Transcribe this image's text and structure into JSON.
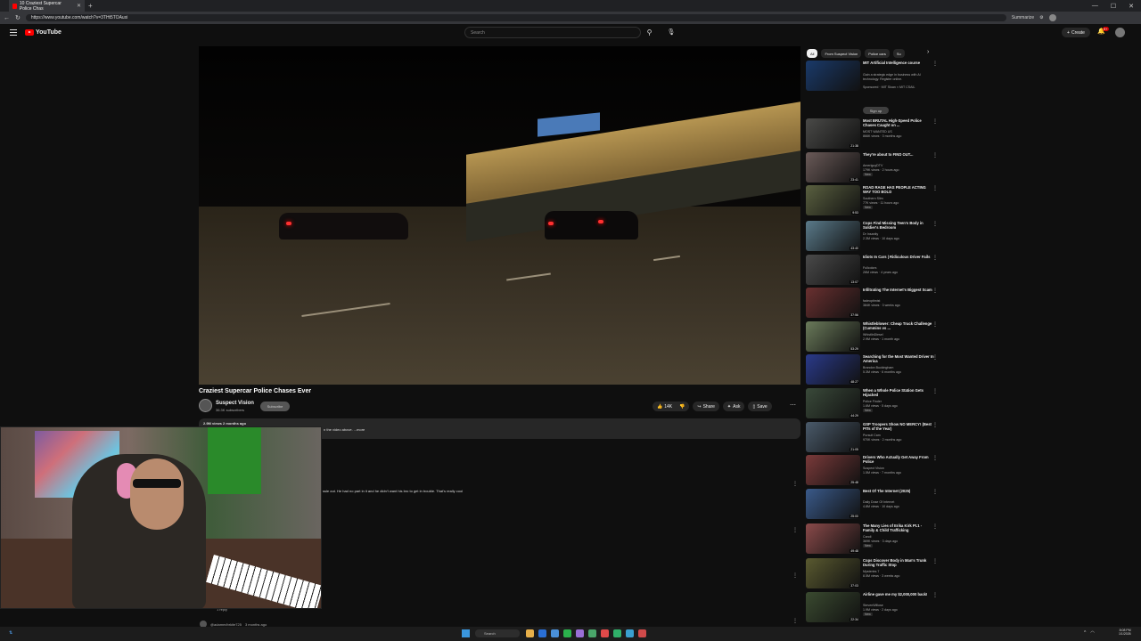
{
  "browser": {
    "tab_title": "10 Craziest Supercar Police Chas",
    "url": "https://www.youtube.com/watch?v=3THt5TOAuxi",
    "profile_label": "Summarize"
  },
  "youtube": {
    "logo_text": "YouTube",
    "search_placeholder": "Search",
    "create_label": "Create",
    "notification_count": "9+"
  },
  "video": {
    "title": "Craziest Supercar Police Chases Ever",
    "channel_name": "Suspect Vision",
    "channel_subs": "36.3K subscribers",
    "subscribe_label": "Subscribe",
    "like_count": "14K",
    "share_label": "Share",
    "ask_label": "Ask",
    "save_label": "Save",
    "views_date": "2.9M views  2 months ago",
    "description_snippet": "n the video above.  ...more"
  },
  "comments": {
    "comment_text": "ssle out. He had no part in it and he didn't want his bro to get in trouble. That's really cool",
    "reply_label": "1 reply",
    "author": "@adamm/brkite725",
    "author_time": "3 months ago"
  },
  "sidebar": {
    "chips": [
      "All",
      "From Suspect Vision",
      "Police cars",
      "Su"
    ],
    "signup_label": "Sign up",
    "items": [
      {
        "title": "MIT Artificial Intelligence course",
        "channel": "Gain a strategic edge in business with AI technology. Register online.",
        "meta": "Sponsored · MIT Sloan × MIT CSAIL",
        "duration": "",
        "badge": "",
        "thumb": "#1a3a6a"
      },
      {
        "title": "Most BRUTAL High-Speed Police Chases Caught on ...",
        "channel": "MOST WANTED US",
        "meta": "866K views · 3 months ago",
        "duration": "21:38",
        "badge": "",
        "thumb": "#4a4a48"
      },
      {
        "title": "They're about to FIND OUT...",
        "channel": "AmeriguyDTV",
        "meta": "179K views · 2 hours ago",
        "duration": "23:41",
        "badge": "New",
        "thumb": "#6a5a58"
      },
      {
        "title": "ROAD RAGE HAS PEOPLE ACTING WAY TOO BOLD",
        "channel": "Southern Slim",
        "meta": "77K views · 11 hours ago",
        "duration": "9:53",
        "badge": "New",
        "thumb": "#5a6040"
      },
      {
        "title": "Cops Find Missing Teen's Body in Soldier's Bedroom",
        "channel": "Dr Insanity",
        "meta": "2.3M views · 10 days ago",
        "duration": "43:40",
        "badge": "",
        "thumb": "#5a7a8a"
      },
      {
        "title": "Idiots In Cars | Ridiculous Driver Fails",
        "channel": "Fullcolors",
        "meta": "26M views · 4 years ago",
        "duration": "13:07",
        "badge": "",
        "thumb": "#4a4a4a"
      },
      {
        "title": "Infiltrating The Internet's Biggest Scam",
        "channel": "fadeoptimist",
        "meta": "384K views · 3 weeks ago",
        "duration": "37:56",
        "badge": "",
        "thumb": "#6a3030"
      },
      {
        "title": "Whistleblower: Cheap Truck Challenge (Cummins vs ...",
        "channel": "WhistlinDiesel",
        "meta": "2.9M views · 1 month ago",
        "duration": "53:29",
        "badge": "",
        "thumb": "#6a7a5a"
      },
      {
        "title": "Searching for the Most Wanted Driver In America",
        "channel": "Brandon Buckingham",
        "meta": "5.3M views · 6 months ago",
        "duration": "48:27",
        "badge": "",
        "thumb": "#2a3a8a"
      },
      {
        "title": "When a Whole Police Station Gets Hijacked",
        "channel": "Police Finder",
        "meta": "1.6M views · 5 days ago",
        "duration": "44:29",
        "badge": "New",
        "thumb": "#3a4a3a"
      },
      {
        "title": "GSP Troopers Show NO MERCY! (Best PITs of the Year)",
        "channel": "Pursuit Cam",
        "meta": "970K views · 2 months ago",
        "duration": "21:05",
        "badge": "",
        "thumb": "#4a5a6a"
      },
      {
        "title": "Drivers Who Actually Get Away From Police",
        "channel": "Suspect Vision",
        "meta": "1.5M views · 7 months ago",
        "duration": "25:48",
        "badge": "",
        "thumb": "#7a3a3a"
      },
      {
        "title": "Best Of The Internet (2025)",
        "channel": "Daily Dose Of Internet",
        "meta": "4.8M views · 10 days ago",
        "duration": "25:00",
        "badge": "",
        "thumb": "#3a5a8a"
      },
      {
        "title": "The Many Lies of Erika Kirk Pt.1 - Family & Child Trafficking",
        "channel": "Candi",
        "meta": "369K views · 3 days ago",
        "duration": "49:48",
        "badge": "New",
        "thumb": "#8a4a4a"
      },
      {
        "title": "Cops Discover Body in Man's Trunk During Traffic Stop",
        "channel": "Mysteries 7",
        "meta": "8.5M views · 3 weeks ago",
        "duration": "37:03",
        "badge": "",
        "thumb": "#5a5a30"
      },
      {
        "title": "Airline gave me my $2,000,000 back!",
        "channel": "StevenWillose",
        "meta": "1.9M views · 2 days ago",
        "duration": "22:34",
        "badge": "New",
        "thumb": "#3a4a30"
      }
    ]
  },
  "taskbar": {
    "search_label": "Search",
    "time": "8:08 PM",
    "date": "1/1/2026",
    "icon_colors": [
      "#e8b04a",
      "#2a6fd6",
      "#4a90d9",
      "#2bb24c",
      "#9a6fd6",
      "#4aa56a",
      "#e04a4a",
      "#30b06a",
      "#3aa0d0",
      "#d04a4a"
    ]
  },
  "colors": {
    "accent": "#ff0000",
    "background": "#0f0f0f"
  }
}
